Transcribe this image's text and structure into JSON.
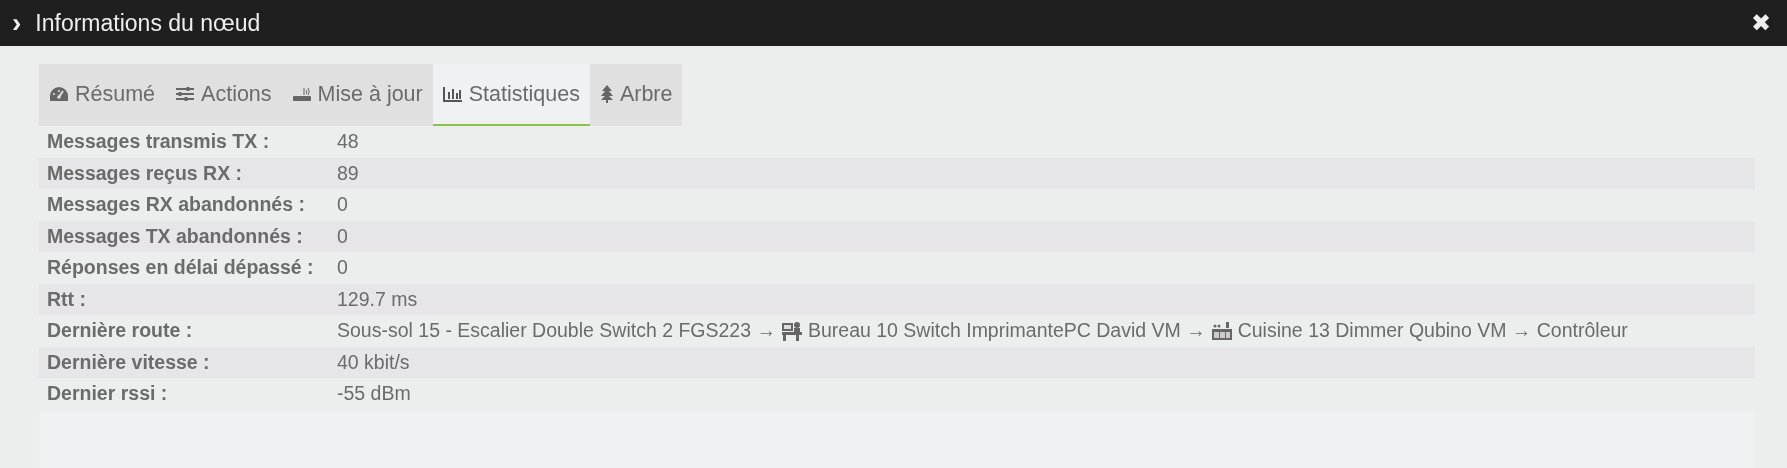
{
  "window": {
    "title": "Informations du nœud",
    "expand_glyph": "›",
    "close_glyph": "✖"
  },
  "tabs": [
    {
      "label": "Résumé",
      "kind": "gauge",
      "selected": false
    },
    {
      "label": "Actions",
      "kind": "sliders",
      "selected": false
    },
    {
      "label": "Mise à jour",
      "kind": "router",
      "selected": false
    },
    {
      "label": "Statistiques",
      "kind": "chart",
      "selected": true
    },
    {
      "label": "Arbre",
      "kind": "tree",
      "selected": false
    }
  ],
  "stats": [
    {
      "kind": "text",
      "label": "Messages transmis TX :",
      "value": "48"
    },
    {
      "kind": "text",
      "label": "Messages reçus RX :",
      "value": "89"
    },
    {
      "kind": "text",
      "label": "Messages RX abandonnés :",
      "value": "0"
    },
    {
      "kind": "text",
      "label": "Messages TX abandonnés :",
      "value": "0"
    },
    {
      "kind": "text",
      "label": "Réponses en délai dépassé :",
      "value": "0"
    },
    {
      "kind": "text",
      "label": "Rtt :",
      "value": "129.7 ms"
    },
    {
      "kind": "route",
      "label": "Dernière route :",
      "segments": [
        {
          "text": "Sous-sol 15 - Escalier Double Switch 2 FGS223 →"
        },
        {
          "kind": "office",
          "text": "Bureau 10 Switch ImprimantePC David VM →"
        },
        {
          "kind": "kitchen",
          "text": "Cuisine 13 Dimmer Qubino VM → Contrôleur"
        }
      ]
    },
    {
      "kind": "text",
      "label": "Dernière vitesse :",
      "value": "40 kbit/s"
    },
    {
      "kind": "text",
      "label": "Dernier rssi :",
      "value": "-55 dBm"
    }
  ]
}
